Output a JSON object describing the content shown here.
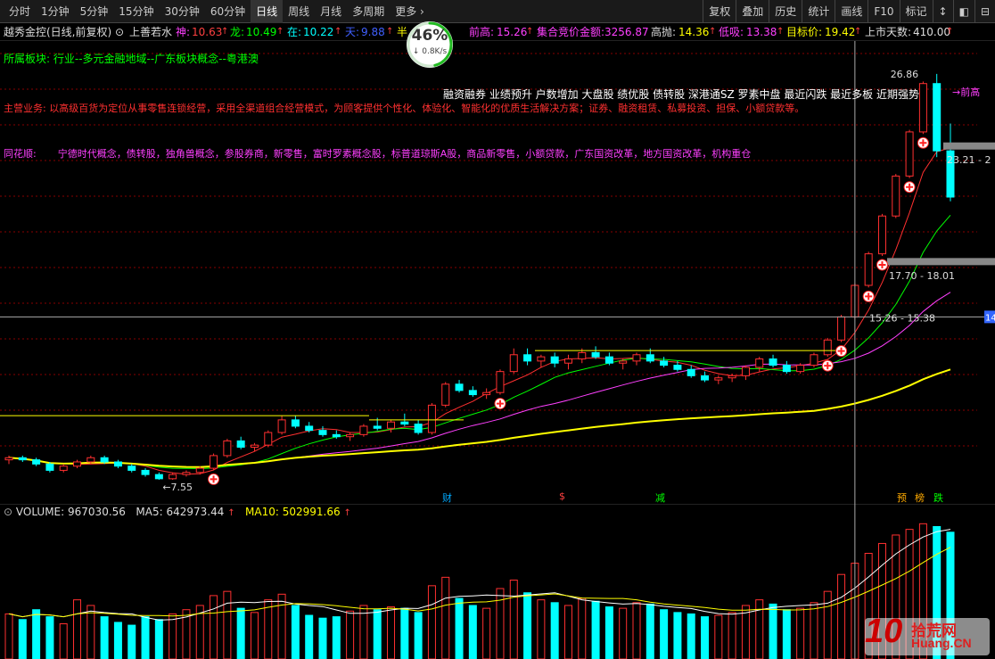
{
  "toolbar": {
    "periods": [
      "分时",
      "1分钟",
      "5分钟",
      "15分钟",
      "30分钟",
      "60分钟",
      "日线",
      "周线",
      "月线",
      "多周期",
      "更多"
    ],
    "active_period": "日线",
    "more_chevron": "›",
    "right_tools": [
      "复权",
      "叠加",
      "历史",
      "统计",
      "画线",
      "F10",
      "标记"
    ],
    "tool_icons": [
      "↕",
      "◧",
      "⊟"
    ]
  },
  "info": {
    "stock_name": "越秀金控(日线,前复权)",
    "dropdown_glyph": "⊙",
    "strategy": "上善若水",
    "shen_label": "神:",
    "shen_value": "10.63",
    "long_label": "龙:",
    "long_value": "10.49",
    "zai_label": "在:",
    "zai_value": "10.22",
    "tian_label": "天:",
    "tian_value": "9.88",
    "partial_label": "半",
    "qiangao_label": "前高:",
    "qiangao_value": "15.26",
    "auction_label": "集合竞价金额:",
    "auction_value": "3256.87",
    "gaopao_label": "高抛:",
    "gaopao_value": "14.36",
    "dixi_label": "低吸:",
    "dixi_value": "13.38",
    "target_label": "目标价:",
    "target_value": "19.42",
    "listed_label": "上市天数:",
    "listed_value": "410.00",
    "arrow": "↑"
  },
  "gauge": {
    "percent": "46%",
    "speed": "↓ 0.8K/s",
    "fraction": 0.46
  },
  "text_blocks": {
    "sector": "所属板块: 行业--多元金融地域--广东板块概念--粤港澳",
    "business": "主营业务: 以高级百货为定位从事零售连锁经营，采用全渠道组合经营模式，为顾客提供个性化、体验化、智能化的优质生活解决方案；证券、融资租赁、私募投资、担保、小额贷款等。",
    "ths_label": "同花顺:",
    "ths_concepts": "宁德时代概念，债转股，独角兽概念，参股券商，新零售，富时罗素概念股，标普道琼斯A股，商品新零售，小额贷款，广东国资改革，地方国资改革，机构重仓",
    "tags": "融资融券 业绩预升 户数增加 大盘股 绩优股 债转股 深港通SZ 罗素中盘 最近闪跌 最近多板 近期强势"
  },
  "kline_labels": {
    "high_price": "26.86",
    "low_price": "7.55",
    "qiangao_tag": "前高",
    "range_1": "23.21 - 2",
    "range_2": "17.70 - 18.01",
    "range_3": "15.26 - 15.38",
    "right_edge": "14"
  },
  "events": [
    {
      "label": "财",
      "color": "#00aaff"
    },
    {
      "label": "$",
      "color": "#ff4040"
    },
    {
      "label": "减",
      "color": "#00ff00"
    },
    {
      "label": "预",
      "color": "#ffaa00"
    },
    {
      "label": "榜",
      "color": "#ffaa00"
    },
    {
      "label": "跌",
      "color": "#00ff00"
    }
  ],
  "volume": {
    "label": "VOLUME:",
    "value": "967030.56",
    "ma5_label": "MA5:",
    "ma5_value": "642973.44",
    "ma10_label": "MA10:",
    "ma10_value": "502991.66"
  },
  "watermark": {
    "brand_number": "10",
    "brand_cn": "拾荒网",
    "brand_site": "Huang.CN"
  },
  "colors": {
    "up": "#ff3030",
    "down": "#00ffff",
    "ma_yellow": "#ffff00",
    "ma_purple": "#ff40ff",
    "ma_green": "#00ff00",
    "ma_red": "#ff3030",
    "grid": "#880000"
  },
  "chart_data": {
    "type": "candlestick",
    "series": [
      {
        "name": "K",
        "ohlc": [
          [
            8.5,
            8.7,
            8.3,
            8.6
          ],
          [
            8.6,
            8.7,
            8.4,
            8.5
          ],
          [
            8.5,
            8.6,
            8.2,
            8.3
          ],
          [
            8.3,
            8.4,
            7.9,
            8.0
          ],
          [
            8.0,
            8.3,
            7.9,
            8.2
          ],
          [
            8.2,
            8.5,
            8.1,
            8.4
          ],
          [
            8.4,
            8.7,
            8.3,
            8.6
          ],
          [
            8.6,
            8.7,
            8.3,
            8.4
          ],
          [
            8.4,
            8.5,
            8.1,
            8.2
          ],
          [
            8.2,
            8.3,
            7.9,
            8.0
          ],
          [
            8.0,
            8.1,
            7.7,
            7.8
          ],
          [
            7.8,
            7.9,
            7.55,
            7.6
          ],
          [
            7.6,
            7.9,
            7.55,
            7.8
          ],
          [
            7.8,
            8.0,
            7.7,
            7.9
          ],
          [
            7.9,
            8.2,
            7.8,
            8.1
          ],
          [
            8.1,
            8.8,
            8.0,
            8.7
          ],
          [
            8.7,
            9.5,
            8.6,
            9.4
          ],
          [
            9.4,
            9.6,
            9.0,
            9.1
          ],
          [
            9.1,
            9.3,
            8.9,
            9.2
          ],
          [
            9.2,
            9.9,
            9.1,
            9.8
          ],
          [
            9.8,
            10.6,
            9.7,
            10.4
          ],
          [
            10.4,
            10.6,
            10.0,
            10.1
          ],
          [
            10.1,
            10.3,
            9.8,
            9.9
          ],
          [
            9.9,
            10.1,
            9.6,
            9.7
          ],
          [
            9.7,
            9.9,
            9.5,
            9.6
          ],
          [
            9.6,
            9.8,
            9.4,
            9.7
          ],
          [
            9.7,
            10.2,
            9.6,
            10.1
          ],
          [
            10.1,
            10.5,
            9.9,
            10.0
          ],
          [
            10.0,
            10.4,
            9.8,
            10.3
          ],
          [
            10.3,
            10.7,
            10.1,
            10.2
          ],
          [
            10.2,
            10.4,
            9.7,
            9.8
          ],
          [
            9.8,
            11.2,
            9.7,
            11.1
          ],
          [
            11.1,
            12.2,
            11.0,
            12.1
          ],
          [
            12.1,
            12.3,
            11.7,
            11.8
          ],
          [
            11.8,
            12.0,
            11.5,
            11.6
          ],
          [
            11.6,
            11.9,
            11.4,
            11.7
          ],
          [
            11.7,
            12.8,
            11.6,
            12.7
          ],
          [
            12.7,
            13.8,
            12.6,
            13.5
          ],
          [
            13.5,
            13.8,
            13.0,
            13.2
          ],
          [
            13.2,
            13.5,
            12.9,
            13.4
          ],
          [
            13.4,
            13.6,
            12.9,
            13.1
          ],
          [
            13.1,
            13.5,
            12.8,
            13.3
          ],
          [
            13.3,
            13.8,
            13.1,
            13.6
          ],
          [
            13.6,
            13.9,
            13.3,
            13.4
          ],
          [
            13.4,
            13.6,
            13.0,
            13.1
          ],
          [
            13.1,
            13.3,
            12.8,
            13.2
          ],
          [
            13.2,
            13.6,
            13.0,
            13.5
          ],
          [
            13.5,
            13.8,
            13.1,
            13.2
          ],
          [
            13.2,
            13.4,
            12.9,
            13.0
          ],
          [
            13.0,
            13.2,
            12.7,
            12.8
          ],
          [
            12.8,
            13.0,
            12.4,
            12.5
          ],
          [
            12.5,
            12.7,
            12.2,
            12.3
          ],
          [
            12.3,
            12.5,
            12.1,
            12.4
          ],
          [
            12.4,
            12.6,
            12.2,
            12.5
          ],
          [
            12.5,
            13.0,
            12.3,
            12.9
          ],
          [
            12.9,
            13.4,
            12.7,
            13.3
          ],
          [
            13.3,
            13.5,
            12.9,
            13.0
          ],
          [
            13.0,
            13.2,
            12.6,
            12.7
          ],
          [
            12.7,
            13.1,
            12.6,
            13.0
          ],
          [
            13.0,
            13.6,
            12.9,
            13.5
          ],
          [
            13.5,
            14.3,
            13.4,
            14.2
          ],
          [
            14.2,
            15.4,
            14.1,
            15.3
          ],
          [
            15.3,
            16.9,
            15.2,
            16.8
          ],
          [
            16.8,
            18.4,
            16.7,
            18.3
          ],
          [
            18.3,
            20.2,
            18.2,
            20.1
          ],
          [
            20.1,
            22.1,
            20.0,
            22.0
          ],
          [
            22.0,
            24.2,
            21.9,
            24.1
          ],
          [
            24.1,
            26.5,
            24.0,
            26.4
          ],
          [
            26.4,
            26.86,
            22.9,
            23.2
          ],
          [
            23.2,
            24.5,
            20.8,
            21.0
          ]
        ]
      }
    ],
    "volume": [
      320,
      280,
      350,
      300,
      250,
      420,
      380,
      300,
      260,
      240,
      300,
      280,
      320,
      350,
      380,
      450,
      480,
      360,
      330,
      420,
      460,
      380,
      310,
      290,
      300,
      340,
      380,
      350,
      370,
      360,
      330,
      520,
      580,
      430,
      380,
      360,
      500,
      560,
      470,
      420,
      400,
      380,
      430,
      410,
      370,
      360,
      400,
      390,
      350,
      330,
      320,
      300,
      310,
      330,
      380,
      420,
      390,
      350,
      360,
      400,
      480,
      600,
      680,
      750,
      820,
      880,
      920,
      960,
      940,
      900
    ],
    "ylim": [
      7,
      28
    ],
    "vol_ylim": [
      0,
      1000
    ]
  }
}
